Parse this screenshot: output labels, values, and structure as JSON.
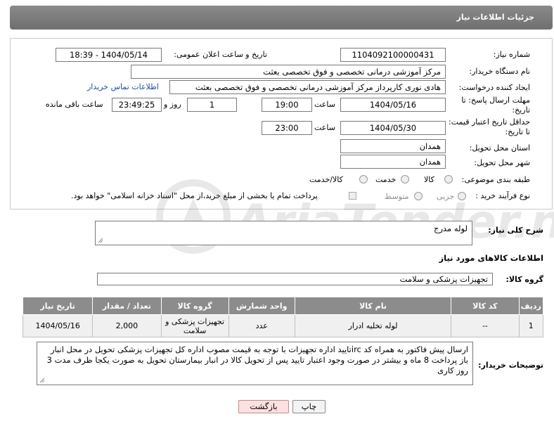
{
  "header": {
    "title": "جزئیات اطلاعات نیاز"
  },
  "form": {
    "need_number_label": "شماره نیاز:",
    "need_number": "1104092100000431",
    "announce_label": "تاریخ و ساعت اعلان عمومی:",
    "announce_value": "1404/05/14 - 18:39",
    "buyer_org_label": "نام دستگاه خریدار:",
    "buyer_org": "مرکز آموزشی درمانی تخصصی و فوق تخصصی بعثت",
    "requester_label": "ایجاد کننده درخواست:",
    "requester": "هادی نوری کارپرداز مرکز آموزشی درمانی تخصصی و فوق تخصصی بعثت",
    "contact_link": "اطلاعات تماس خریدار",
    "reply_deadline_label": "مهلت ارسال پاسخ: تا تاریخ:",
    "reply_date": "1404/05/16",
    "time_label": "ساعت",
    "reply_time": "19:00",
    "days_value": "1",
    "days_label": "روز و",
    "remaining_time": "23:49:25",
    "remaining_label": "ساعت باقی مانده",
    "price_validity_label": "حداقل تاریخ اعتبار قیمت: تا تاریخ:",
    "validity_date": "1404/05/30",
    "validity_time": "23:00",
    "province_label": "استان محل تحویل:",
    "province": "همدان",
    "city_label": "شهر محل تحویل:",
    "city": "همدان",
    "category_label": "طبقه بندی موضوعی:",
    "category_options": [
      "کالا",
      "خدمت",
      "کالا/خدمت"
    ],
    "process_label": "نوع فرآیند خرید :",
    "process_options": [
      "جزیی",
      "متوسط"
    ],
    "payment_note": "پرداخت تمام یا بخشی از مبلغ خرید،از محل \"اسناد خزانه اسلامی\" خواهد بود."
  },
  "summary": {
    "label": "شرح کلی نیاز:",
    "value": "لوله مدرج"
  },
  "goods_info_title": "اطلاعات کالاهای مورد نیاز",
  "goods_group": {
    "label": "گروه کالا:",
    "value": "تجهیزات پزشکی و سلامت"
  },
  "table": {
    "headers": [
      "ردیف",
      "کد کالا",
      "نام کالا",
      "واحد شمارش",
      "گروه کالا",
      "تعداد / مقدار",
      "تاریخ نیاز"
    ],
    "rows": [
      [
        "1",
        "--",
        "لوله تخلیه ادرار",
        "عدد",
        "تجهیزات پزشکی و سلامت",
        "2,000",
        "1404/05/16"
      ]
    ]
  },
  "buyer_notes": {
    "label": "توضیحات خریدار:",
    "value": "ارسال پیش فاکتور به همراه کد ircتایید اداره تجهیزات  با توجه به قیمت مصوب اداره کل تجهیزات پزشکی تحویل در محل انبار باز پرداخت 8 ماه و بیشتر در صورت وجود اعتبار  تایید پس از تحویل کالا در انبار بیمارستان  تحویل به صورت یکجا ظرف مدت 3 روز کاری"
  },
  "buttons": {
    "print": "چاپ",
    "back": "بازگشت"
  },
  "watermark": "AriaTender.net"
}
